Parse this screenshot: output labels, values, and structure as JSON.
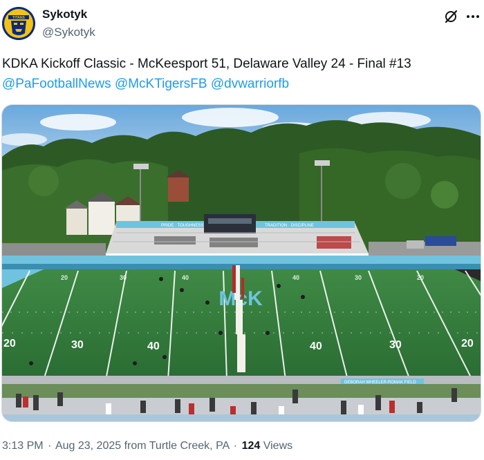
{
  "author": {
    "display_name": "Sykotyk",
    "handle": "@Sykotyk"
  },
  "tweet": {
    "text": "KDKA Kickoff Classic - McKeesport 51, Delaware Valley 24 - Final #13",
    "mentions": [
      "@PaFootballNews",
      "@McKTigersFB",
      "@dvwarriorfb"
    ]
  },
  "media": {
    "field_logo_text": "McK",
    "yard_numbers": [
      "20",
      "30",
      "40",
      "40",
      "30",
      "20"
    ],
    "far_yard_numbers": [
      "20",
      "30",
      "40",
      "40",
      "30",
      "20"
    ],
    "press_box_banner": "PRIDE · TOUGHNESS · HEART",
    "stand_banner_right": "TRADITION · DISCIPLINE",
    "sideline_banner": "DEBORAH WHEELER-ROMAK FIELD"
  },
  "meta": {
    "time": "3:13 PM",
    "date": "Aug 23, 2025",
    "location": "from Turtle Creek, PA",
    "views_count": "124",
    "views_label": "Views",
    "separator": "·"
  },
  "icons": {
    "grok": "grok-icon",
    "more": "more-icon"
  },
  "colors": {
    "link": "#1d9bf0",
    "text": "#0f1419",
    "secondary": "#536471",
    "turf": "#2f7a3a",
    "logo": "#6fc3df"
  }
}
